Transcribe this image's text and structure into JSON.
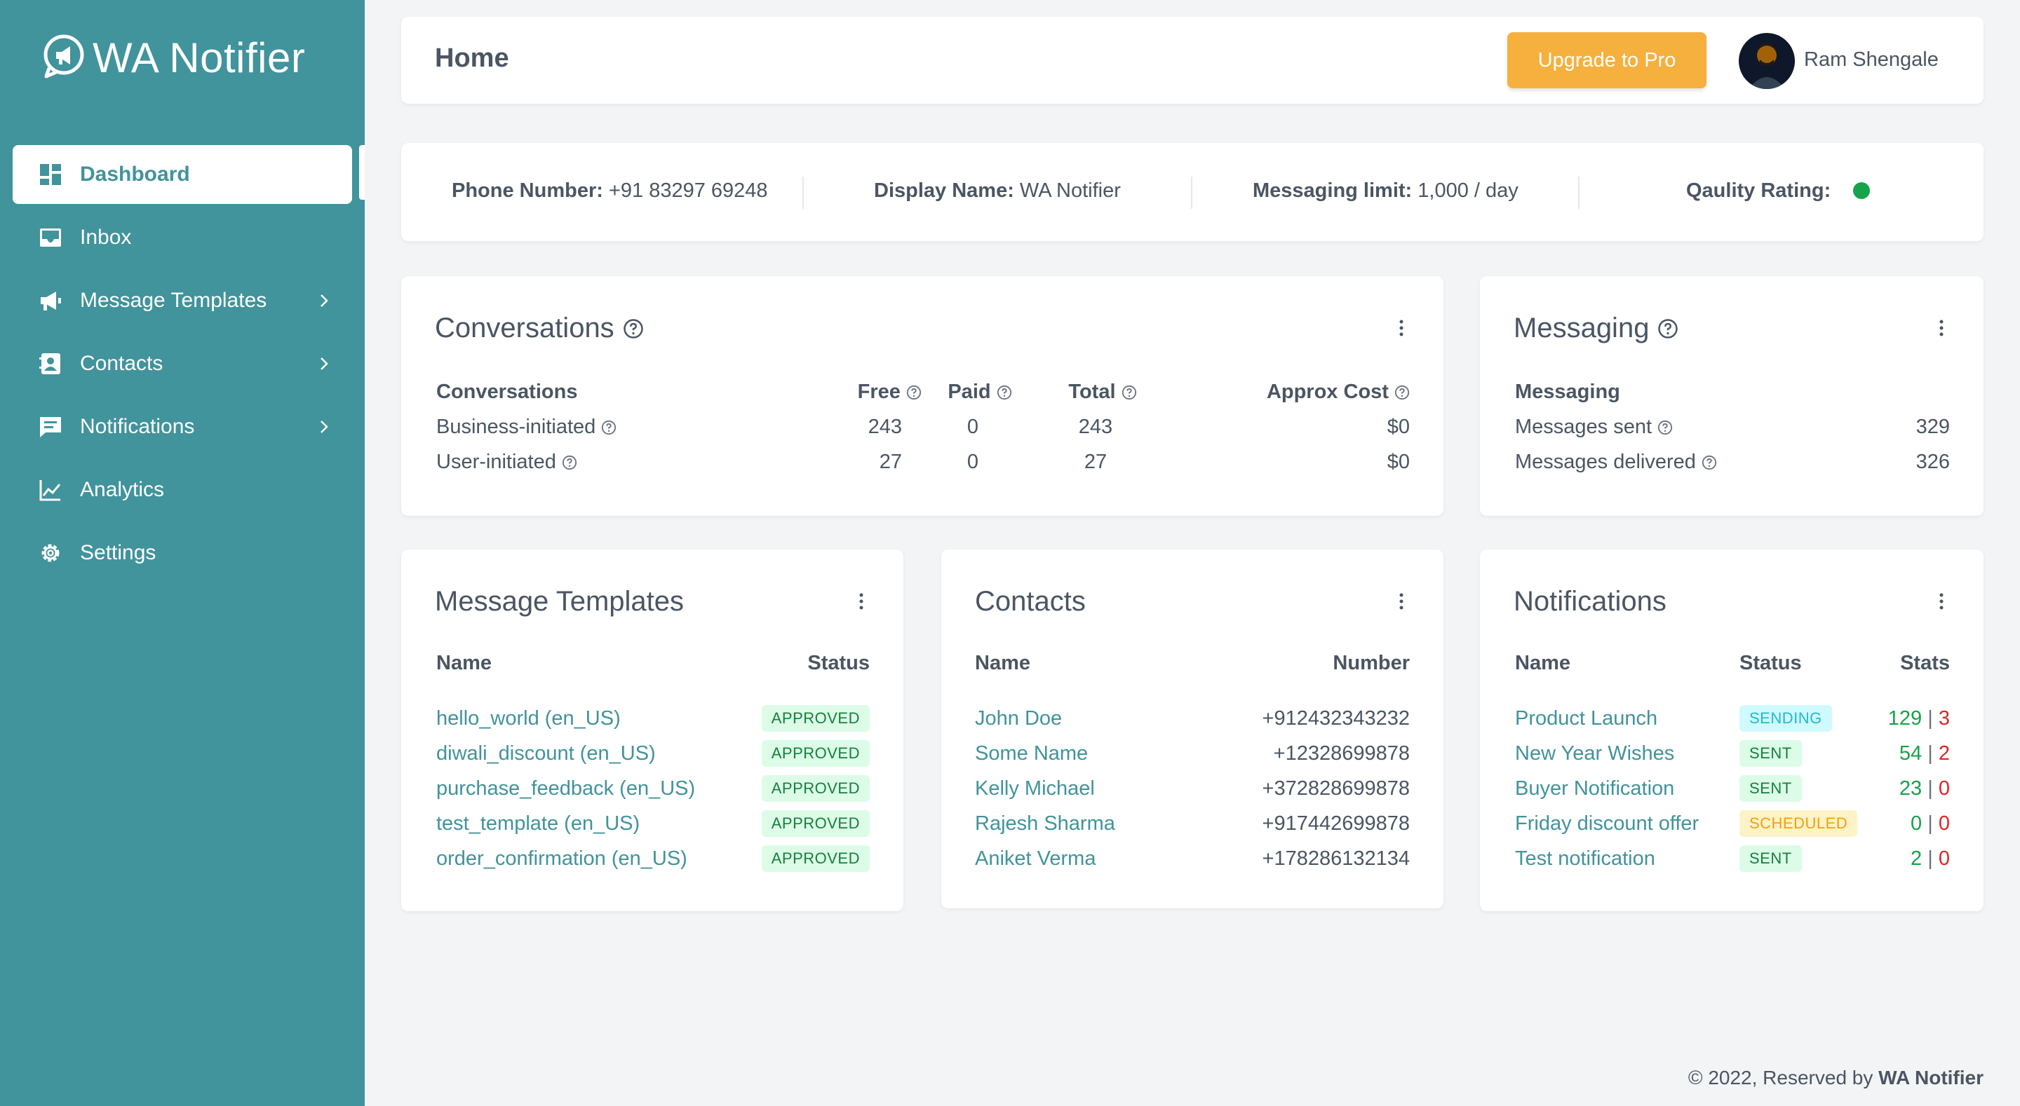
{
  "brand": {
    "name": "WA Notifier"
  },
  "colors": {
    "primary": "#41939c",
    "accent": "#f6b03e",
    "quality": "#16a34a"
  },
  "nav": [
    {
      "label": "Dashboard",
      "icon": "dashboard-icon",
      "active": true
    },
    {
      "label": "Inbox",
      "icon": "inbox-icon"
    },
    {
      "label": "Message Templates",
      "icon": "megaphone-icon",
      "submenu": true
    },
    {
      "label": "Contacts",
      "icon": "contacts-icon",
      "submenu": true
    },
    {
      "label": "Notifications",
      "icon": "chat-icon",
      "submenu": true
    },
    {
      "label": "Analytics",
      "icon": "chart-icon"
    },
    {
      "label": "Settings",
      "icon": "gear-icon"
    }
  ],
  "header": {
    "title": "Home",
    "upgrade_label": "Upgrade to Pro",
    "user_name": "Ram Shengale"
  },
  "info": {
    "phone_label": "Phone Number:",
    "phone": "+91 83297 69248",
    "display_label": "Display Name:",
    "display": "WA Notifier",
    "limit_label": "Messaging limit:",
    "limit": "1,000 / day",
    "quality_label": "Qaulity Rating:"
  },
  "conversations": {
    "title": "Conversations",
    "headers": [
      "Conversations",
      "Free",
      "Paid",
      "Total",
      "Approx Cost"
    ],
    "rows": [
      {
        "name": "Business-initiated",
        "free": "243",
        "paid": "0",
        "total": "243",
        "cost": "$0"
      },
      {
        "name": "User-initiated",
        "free": "27",
        "paid": "0",
        "total": "27",
        "cost": "$0"
      }
    ]
  },
  "messaging": {
    "title": "Messaging",
    "header": "Messaging",
    "rows": [
      {
        "name": "Messages sent",
        "value": "329"
      },
      {
        "name": "Messages delivered",
        "value": "326"
      }
    ]
  },
  "templates": {
    "title": "Message Templates",
    "headers": [
      "Name",
      "Status"
    ],
    "rows": [
      {
        "name": "hello_world (en_US)",
        "status": "APPROVED"
      },
      {
        "name": "diwali_discount (en_US)",
        "status": "APPROVED"
      },
      {
        "name": "purchase_feedback (en_US)",
        "status": "APPROVED"
      },
      {
        "name": "test_template (en_US)",
        "status": "APPROVED"
      },
      {
        "name": "order_confirmation (en_US)",
        "status": "APPROVED"
      }
    ]
  },
  "contacts": {
    "title": "Contacts",
    "headers": [
      "Name",
      "Number"
    ],
    "rows": [
      {
        "name": "John Doe",
        "number": "+912432343232"
      },
      {
        "name": "Some Name",
        "number": "+12328699878"
      },
      {
        "name": "Kelly Michael",
        "number": "+372828699878"
      },
      {
        "name": "Rajesh Sharma",
        "number": "+917442699878"
      },
      {
        "name": "Aniket Verma",
        "number": "+178286132134"
      }
    ]
  },
  "notifications": {
    "title": "Notifications",
    "headers": [
      "Name",
      "Status",
      "Stats"
    ],
    "rows": [
      {
        "name": "Product Launch",
        "status": "SENDING",
        "badge": "b-sending",
        "ok": "129",
        "sep": "|",
        "fail": "3"
      },
      {
        "name": "New Year Wishes",
        "status": "SENT",
        "badge": "b-sent",
        "ok": "54",
        "sep": "|",
        "fail": "2"
      },
      {
        "name": "Buyer Notification",
        "status": "SENT",
        "badge": "b-sent",
        "ok": "23",
        "sep": "|",
        "fail": "0"
      },
      {
        "name": "Friday discount offer",
        "status": "SCHEDULED",
        "badge": "b-scheduled",
        "ok": "0",
        "sep": "|",
        "fail": "0"
      },
      {
        "name": "Test notification",
        "status": "SENT",
        "badge": "b-sent",
        "ok": "2",
        "sep": "|",
        "fail": "0"
      }
    ]
  },
  "footer": {
    "prefix": "© 2022, Reserved by",
    "brand": "WA Notifier"
  }
}
